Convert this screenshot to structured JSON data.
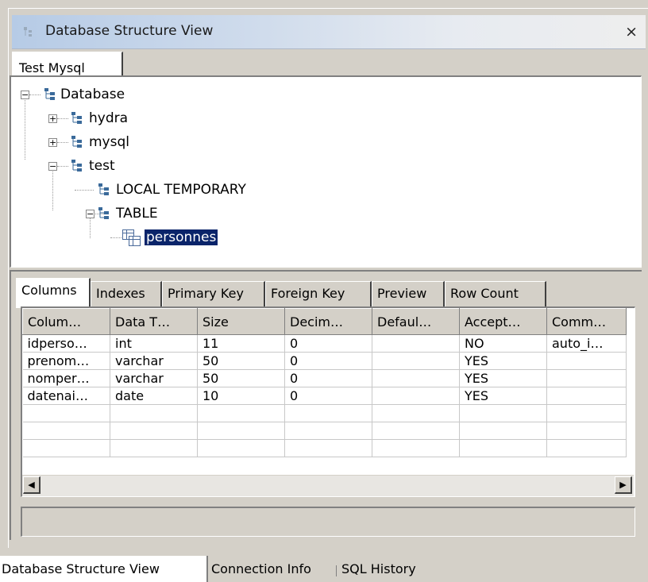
{
  "window": {
    "title": "Database Structure View",
    "close_symbol": "×"
  },
  "connection_tab": {
    "label": "Test Mysql"
  },
  "tree": {
    "root": "Database",
    "schemas": [
      "hydra",
      "mysql",
      "test"
    ],
    "test_children": [
      "LOCAL TEMPORARY",
      "TABLE"
    ],
    "table_children": [
      "personnes"
    ],
    "selected": "personnes",
    "expand_symbol": "+",
    "collapse_symbol": "−",
    "icons": {
      "schema": "schema-icon",
      "table": "table-icon"
    }
  },
  "detail_tabs": {
    "items": [
      "Columns",
      "Indexes",
      "Primary Key",
      "Foreign Key",
      "Preview",
      "Row Count"
    ],
    "active": "Columns"
  },
  "columns_table": {
    "headers": [
      "Colum…",
      "Data T…",
      "Size",
      "Decim…",
      "Defaul…",
      "Accept…",
      "Comm…"
    ],
    "rows": [
      [
        "idperso…",
        "int",
        "11",
        "0",
        "",
        "NO",
        "auto_i…"
      ],
      [
        "prenom…",
        "varchar",
        "50",
        "0",
        "",
        "YES",
        ""
      ],
      [
        "nomper…",
        "varchar",
        "50",
        "0",
        "",
        "YES",
        ""
      ],
      [
        "datenai…",
        "date",
        "10",
        "0",
        "",
        "YES",
        ""
      ],
      [
        "",
        "",
        "",
        "",
        "",
        "",
        ""
      ],
      [
        "",
        "",
        "",
        "",
        "",
        "",
        ""
      ],
      [
        "",
        "",
        "",
        "",
        "",
        "",
        ""
      ]
    ]
  },
  "scrollbar": {
    "left_arrow": "◀",
    "right_arrow": "▶"
  },
  "bottom_tabs": {
    "items": [
      "Database Structure View",
      "Connection Info",
      "SQL History"
    ],
    "active": "Database Structure View"
  },
  "colors": {
    "selection": "#0a246a",
    "chrome": "#d4d0c8",
    "title_gradient_start": "#b6cbe6"
  }
}
